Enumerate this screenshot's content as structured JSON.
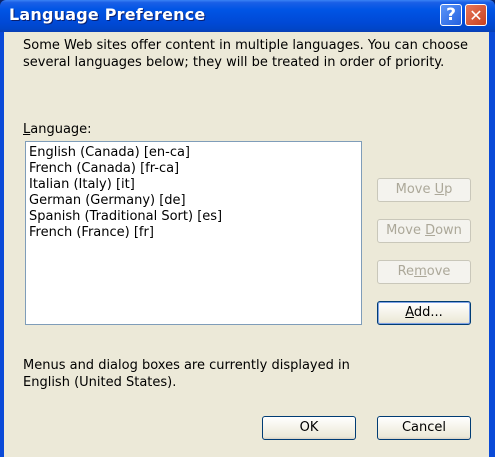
{
  "window": {
    "title": "Language Preference",
    "help_glyph": "?",
    "close_glyph": "✕"
  },
  "dialog": {
    "intro_text": "Some Web sites offer content in multiple languages. You can choose several languages below; they will be treated in order of priority.",
    "language_label": "Language:",
    "languages": [
      "English (Canada) [en-ca]",
      "French (Canada) [fr-ca]",
      "Italian (Italy) [it]",
      "German (Germany) [de]",
      "Spanish (Traditional Sort) [es]",
      "French (France) [fr]"
    ],
    "buttons": {
      "move_up": "Move Up",
      "move_down": "Move Down",
      "remove": "Remove",
      "add": "Add...",
      "ok": "OK",
      "cancel": "Cancel"
    },
    "footer_text": "Menus and dialog boxes are currently displayed in English (United States)."
  },
  "colors": {
    "titlebar": "#0055e5",
    "dialog_bg": "#ece9d8",
    "disabled_text": "#aca899"
  }
}
